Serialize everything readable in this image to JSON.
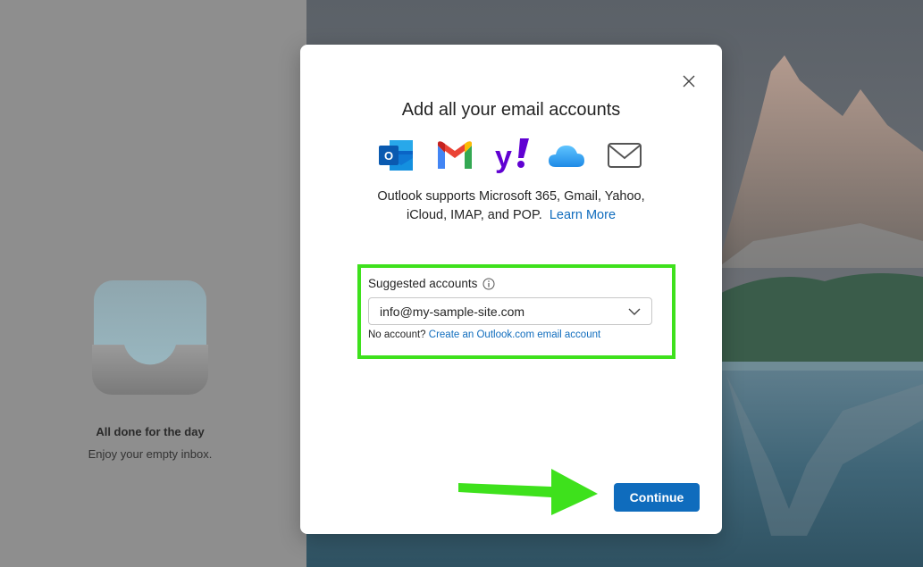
{
  "left_pane": {
    "empty_title": "All done for the day",
    "empty_subtitle": "Enjoy your empty inbox."
  },
  "dialog": {
    "title": "Add all your email accounts",
    "providers": [
      "outlook-icon",
      "gmail-icon",
      "yahoo-icon",
      "icloud-icon",
      "generic-mail-icon"
    ],
    "description_line1": "Outlook supports Microsoft 365, Gmail, Yahoo,",
    "description_line2": "iCloud, IMAP, and POP.",
    "learn_more": "Learn More",
    "suggested_label": "Suggested accounts",
    "suggested_value": "info@my-sample-site.com",
    "no_account_text": "No account?",
    "create_link": "Create an Outlook.com email account",
    "continue_label": "Continue"
  },
  "colors": {
    "accent": "#0f6cbd",
    "highlight": "#3ee11c"
  }
}
